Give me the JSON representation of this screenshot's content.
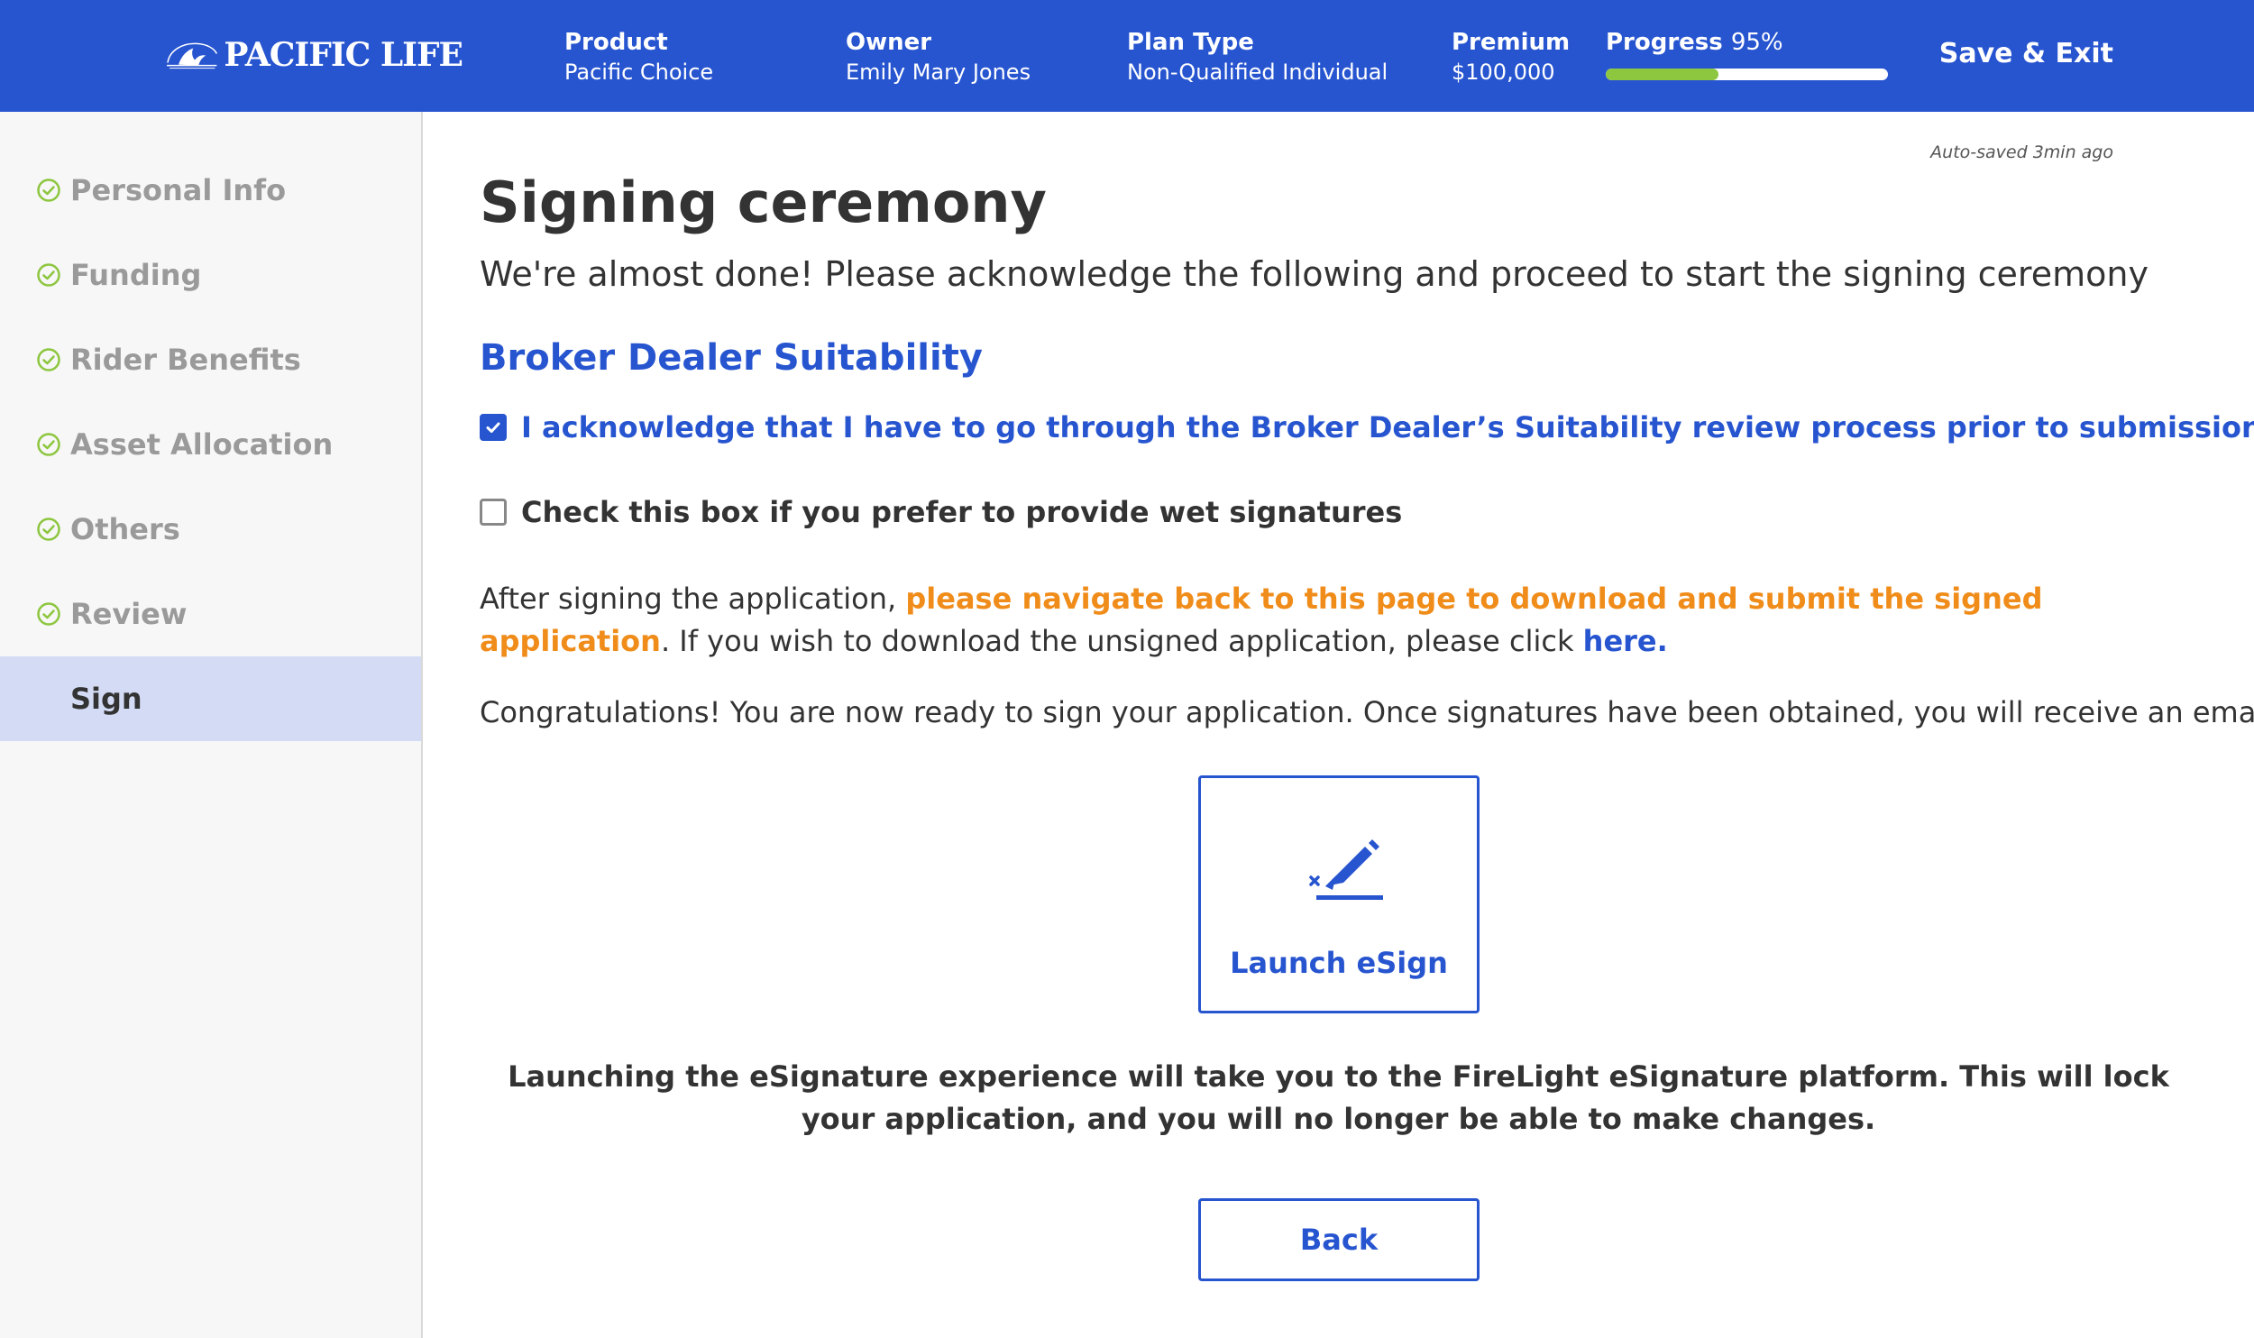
{
  "header": {
    "logo_text": "PACIFIC LIFE",
    "product": {
      "label": "Product",
      "value": "Pacific Choice"
    },
    "owner": {
      "label": "Owner",
      "value": "Emily Mary Jones"
    },
    "plan_type": {
      "label": "Plan Type",
      "value": "Non-Qualified Individual"
    },
    "premium": {
      "label": "Premium",
      "value": "$100,000"
    },
    "progress": {
      "label": "Progress",
      "percent_text": "95%",
      "fill_fraction": 0.4
    },
    "save_exit_label": "Save & Exit",
    "colors": {
      "background": "#2755d0",
      "progress_fill": "#8dc63f"
    }
  },
  "sidebar": {
    "items": [
      {
        "label": "Personal Info",
        "completed": true,
        "icon": "check-circle-icon"
      },
      {
        "label": "Funding",
        "completed": true,
        "icon": "check-circle-icon"
      },
      {
        "label": "Rider Benefits",
        "completed": true,
        "icon": "check-circle-icon"
      },
      {
        "label": "Asset Allocation",
        "completed": true,
        "icon": "check-circle-icon"
      },
      {
        "label": "Others",
        "completed": true,
        "icon": "check-circle-icon"
      },
      {
        "label": "Review",
        "completed": true,
        "icon": "check-circle-icon"
      },
      {
        "label": "Sign",
        "completed": false,
        "active": true
      }
    ]
  },
  "main": {
    "autosaved": "Auto-saved 3min ago",
    "title": "Signing ceremony",
    "subtitle": "We're almost done! Please acknowledge the following and proceed to start the signing ceremony",
    "section_title": "Broker Dealer Suitability",
    "acknowledge": {
      "label": "I acknowledge that I have to go through the Broker Dealer’s Suitability review process prior to submission",
      "checked": true
    },
    "wet_signatures": {
      "label": "Check this box if you prefer to provide wet signatures",
      "checked": false
    },
    "navigate_note": {
      "prefix": "After signing the application, ",
      "highlight": "please navigate back to this page to download and submit the signed application",
      "suffix": ". If you wish to download the unsigned application, please click ",
      "link": "here."
    },
    "congrats": "Congratulations! You are now ready to sign your application. Once signatures have been obtained, you will receive an email.",
    "esign": {
      "label": "Launch eSign",
      "icon": "pen-sign-icon"
    },
    "warning": "Launching the eSignature experience will take you to the FireLight eSignature platform. This will lock your application, and you will no longer be able to make changes.",
    "back_label": "Back",
    "colors": {
      "accent": "#2755d0",
      "highlight": "#f08c1a",
      "check": "#8dc63f",
      "active_nav": "#d4dcf5"
    }
  }
}
